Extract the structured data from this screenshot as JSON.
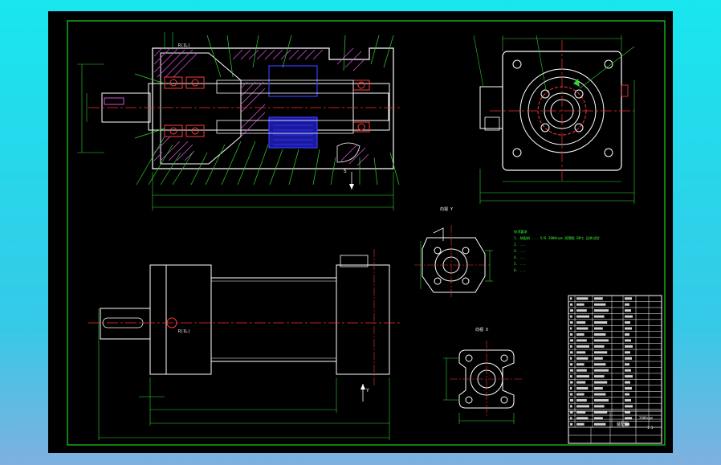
{
  "window": {
    "background_top": "#18e6ef",
    "background_bottom": "#7fb0e0"
  },
  "colors": {
    "sheet": "#000000",
    "outline": "#ffffff",
    "frame": "#1fd01f",
    "center_line": "#ff3030",
    "dimension": "#2fd62f",
    "hatch": "#d54fd5",
    "section": "#3b3bff",
    "bearing": "#ff3a3a",
    "notes": "#37ff37",
    "table": "#ffffff"
  },
  "drawing": {
    "view_labels": {
      "view_y": "向视 Y",
      "view_x": "向视 X",
      "section_s": "S",
      "section_y": "Y"
    },
    "callouts": [
      "R(1L)",
      "R(1L)"
    ],
    "notes": [
      "技术要求",
      "1. 装配前 ... 5/6  2000rpm 润滑脂 80℃ 运转试验",
      "2. ...",
      "3. ...",
      "4. ...",
      "5. ...",
      "6. ..."
    ],
    "title_block": {
      "drawing_title": "装配图",
      "part_code": "2000rpm",
      "scale_label": "1:1"
    }
  }
}
